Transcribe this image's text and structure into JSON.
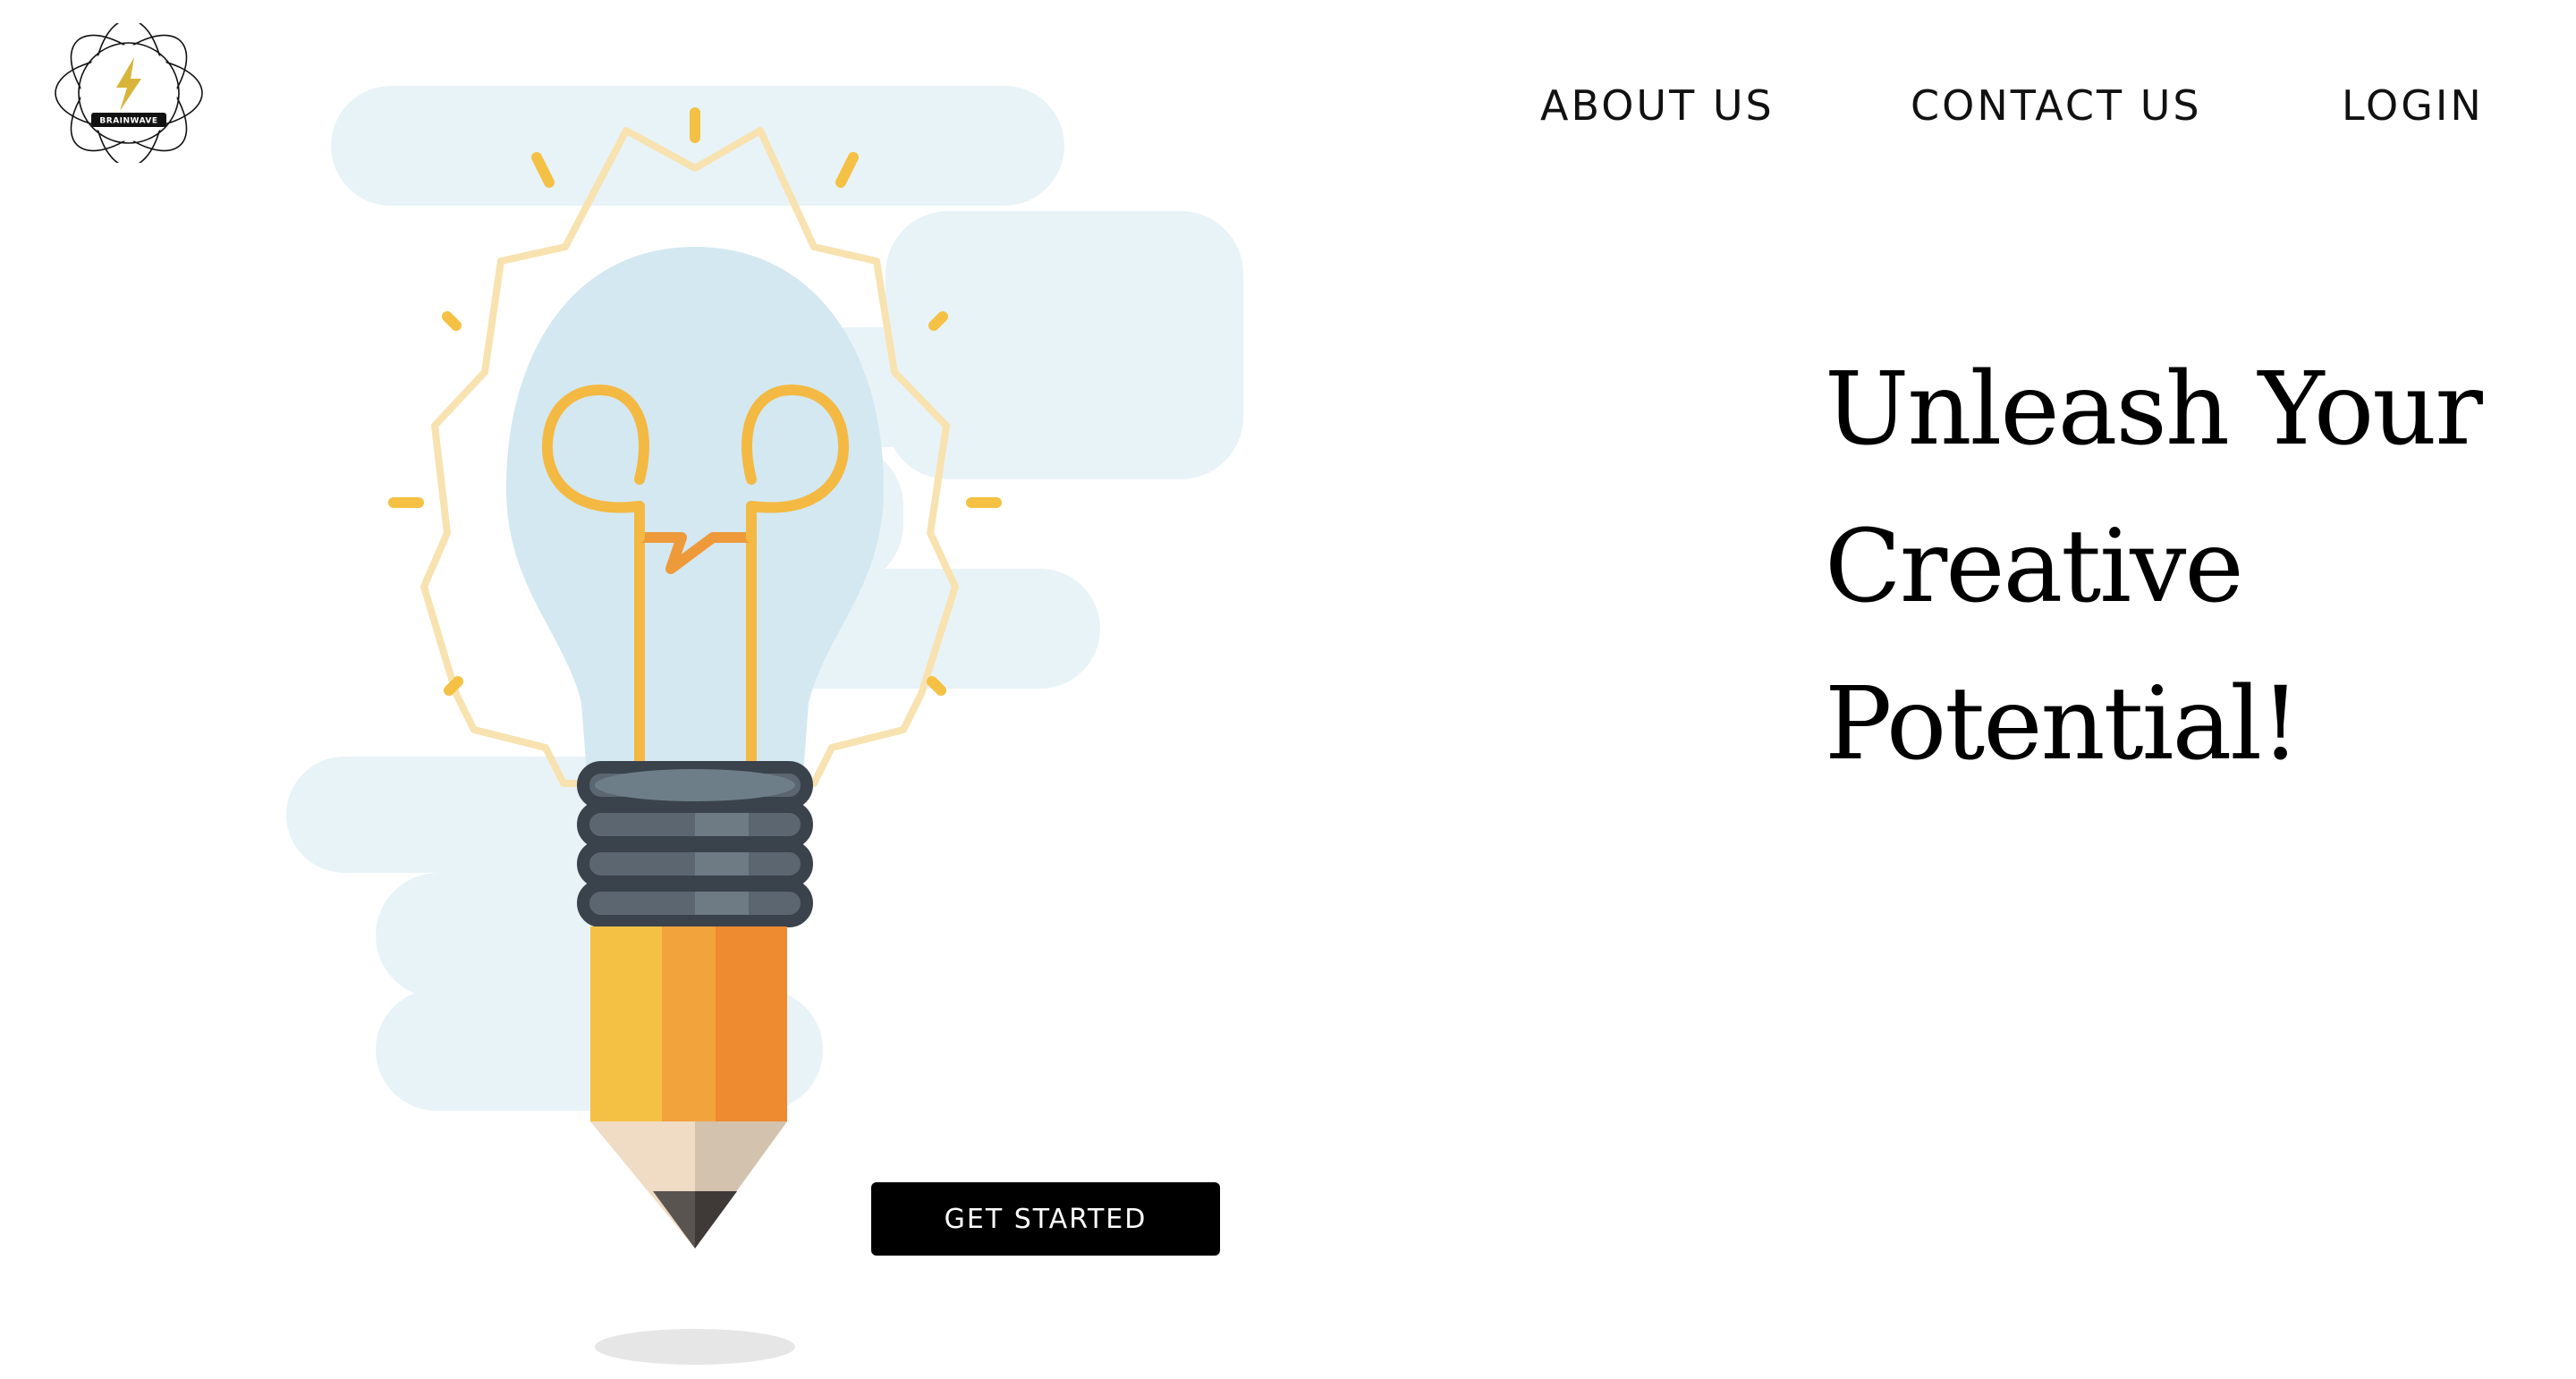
{
  "logo": {
    "text": "BRAINWAVE",
    "icon": "lightning-bolt-icon"
  },
  "nav": {
    "about": "ABOUT US",
    "contact": "CONTACT US",
    "login": "LOGIN"
  },
  "hero": {
    "headline_line1": "Unleash Your",
    "headline_line2": "Creative",
    "headline_line3": "Potential!",
    "cta_label": "GET STARTED",
    "illustration": "lightbulb-pencil-illustration"
  },
  "colors": {
    "accent": "#000000",
    "bulb": "#d4e8f1",
    "filament": "#f4b942",
    "pencil_yellow": "#f4c145",
    "pencil_orange": "#ee8a2f",
    "cloud": "#e8f3f8"
  }
}
